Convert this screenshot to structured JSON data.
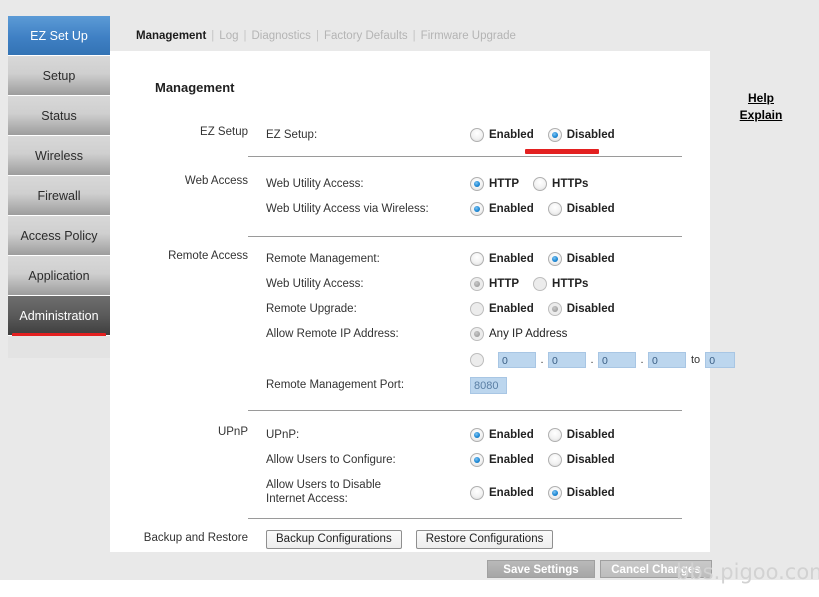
{
  "sidebar": {
    "items": [
      {
        "label": "EZ Set Up",
        "state": "blue"
      },
      {
        "label": "Setup",
        "state": "normal"
      },
      {
        "label": "Status",
        "state": "normal"
      },
      {
        "label": "Wireless",
        "state": "normal"
      },
      {
        "label": "Firewall",
        "state": "normal"
      },
      {
        "label": "Access Policy",
        "state": "normal"
      },
      {
        "label": "Application",
        "state": "normal"
      },
      {
        "label": "Administration",
        "state": "dark-active-annotated"
      }
    ]
  },
  "tabs": {
    "active": "Management",
    "items": [
      "Management",
      "Log",
      "Diagnostics",
      "Factory Defaults",
      "Firmware Upgrade"
    ],
    "separator": "|"
  },
  "help": {
    "line1": "Help",
    "line2": "Explain"
  },
  "page": {
    "title": "Management"
  },
  "sections": {
    "ez_setup": {
      "label": "EZ Setup",
      "row_label": "EZ Setup:",
      "options": [
        {
          "label": "Enabled",
          "selected": false,
          "dim": false
        },
        {
          "label": "Disabled",
          "selected": true,
          "dim": false
        }
      ]
    },
    "web_access": {
      "label": "Web Access",
      "rows": [
        {
          "label": "Web Utility Access:",
          "options": [
            {
              "label": "HTTP",
              "selected": true,
              "dim": false
            },
            {
              "label": "HTTPs",
              "selected": false,
              "dim": false
            }
          ]
        },
        {
          "label": "Web Utility Access via  Wireless:",
          "options": [
            {
              "label": "Enabled",
              "selected": true,
              "dim": false
            },
            {
              "label": "Disabled",
              "selected": false,
              "dim": false
            }
          ]
        }
      ]
    },
    "remote_access": {
      "label": "Remote Access",
      "rows": [
        {
          "label": "Remote Management:",
          "options": [
            {
              "label": "Enabled",
              "selected": false,
              "dim": false
            },
            {
              "label": "Disabled",
              "selected": true,
              "dim": false
            }
          ]
        },
        {
          "label": "Web Utility Access:",
          "options": [
            {
              "label": "HTTP",
              "selected": true,
              "dim": true
            },
            {
              "label": "HTTPs",
              "selected": false,
              "dim": true
            }
          ]
        },
        {
          "label": "Remote Upgrade:",
          "options": [
            {
              "label": "Enabled",
              "selected": false,
              "dim": true
            },
            {
              "label": "Disabled",
              "selected": true,
              "dim": true
            }
          ]
        },
        {
          "label": "Allow Remote IP Address:",
          "options": [
            {
              "label": "Any IP Address",
              "selected": true,
              "dim": true
            }
          ]
        }
      ],
      "ip_range": {
        "radio_selected": false,
        "radio_dim": true,
        "octets": [
          "0",
          "0",
          "0",
          "0"
        ],
        "separator": ".",
        "to_word": "to",
        "range_end": "0"
      },
      "port": {
        "label": "Remote Management Port:",
        "value": "8080"
      }
    },
    "upnp": {
      "label": "UPnP",
      "rows": [
        {
          "label": "UPnP:",
          "options": [
            {
              "label": "Enabled",
              "selected": true,
              "dim": false
            },
            {
              "label": "Disabled",
              "selected": false,
              "dim": false
            }
          ]
        },
        {
          "label": "Allow Users to Configure:",
          "options": [
            {
              "label": "Enabled",
              "selected": true,
              "dim": false
            },
            {
              "label": "Disabled",
              "selected": false,
              "dim": false
            }
          ]
        },
        {
          "label": "Allow Users to Disable<br>Internet Access:",
          "options": [
            {
              "label": "Enabled",
              "selected": false,
              "dim": false
            },
            {
              "label": "Disabled",
              "selected": true,
              "dim": false
            }
          ]
        }
      ]
    },
    "backup": {
      "label": "Backup and Restore",
      "buttons": [
        "Backup Configurations",
        "Restore Configurations"
      ]
    }
  },
  "footer": {
    "save": "Save Settings",
    "cancel": "Cancel Changes"
  },
  "watermark": "bbs.pigoo.com",
  "colors": {
    "accent_blue": "#3f80c4",
    "annotation_red": "#e32020",
    "input_blue": "#bcd6ee",
    "page_bg": "#e9e9e9"
  }
}
